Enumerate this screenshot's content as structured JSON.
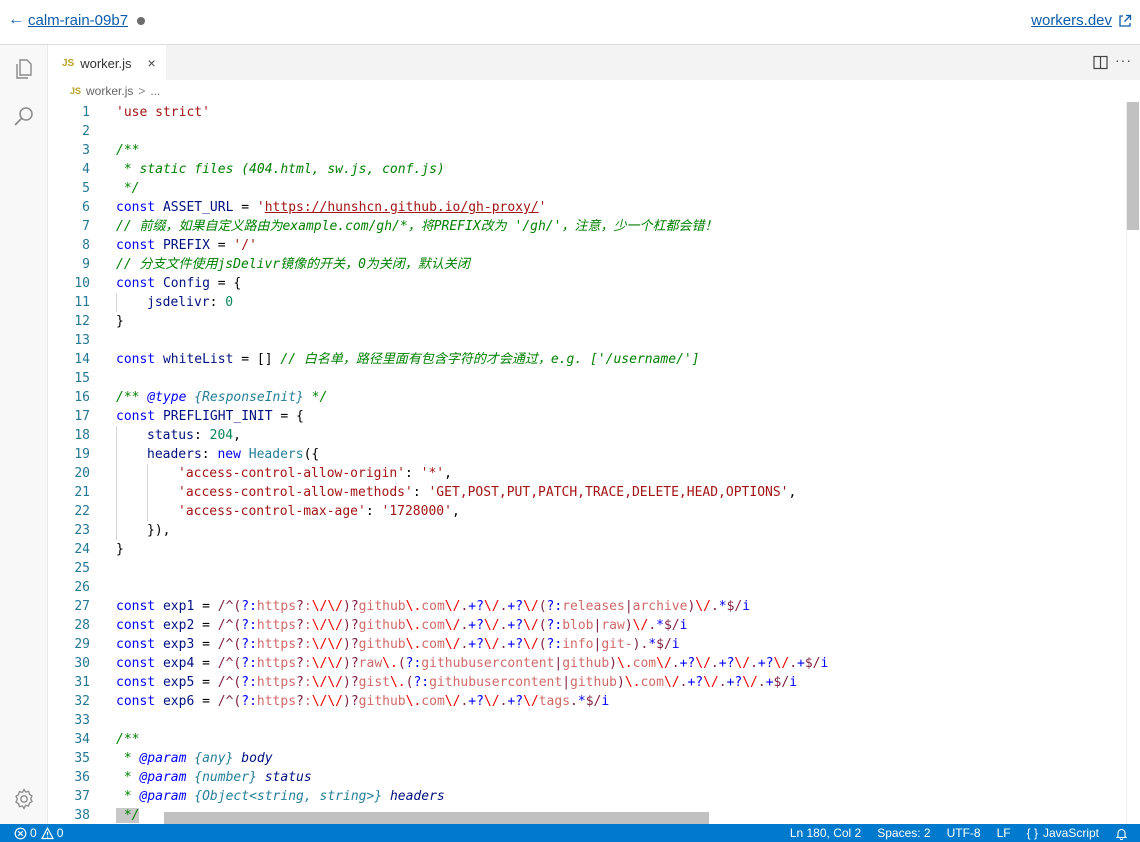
{
  "header": {
    "back_label": "calm-rain-09b7",
    "site_link": "workers.dev"
  },
  "tabs": [
    {
      "icon": "JS",
      "label": "worker.js",
      "close": "×"
    }
  ],
  "breadcrumb": {
    "icon": "JS",
    "file": "worker.js",
    "sep": ">",
    "more": "..."
  },
  "editor": {
    "line_numbers": [
      "1",
      "2",
      "3",
      "4",
      "5",
      "6",
      "7",
      "8",
      "9",
      "10",
      "11",
      "12",
      "13",
      "14",
      "15",
      "16",
      "17",
      "18",
      "19",
      "20",
      "21",
      "22",
      "23",
      "24",
      "25",
      "26",
      "27",
      "28",
      "29",
      "30",
      "31",
      "32",
      "33",
      "34",
      "35",
      "36",
      "37",
      "38"
    ],
    "lines": {
      "l1": "'use strict'",
      "l3": "/**",
      "l4": " * static files (404.html, sw.js, conf.js)",
      "l5": " */",
      "l6_kw": "const",
      "l6_var": " ASSET_URL ",
      "l6_op": "= ",
      "l6_q1": "'",
      "l6_url": "https://hunshcn.github.io/gh-proxy/",
      "l6_q2": "'",
      "l7": "// 前缀，如果自定义路由为example.com/gh/*，将PREFIX改为 '/gh/'，注意，少一个杠都会错！",
      "l8_kw": "const",
      "l8_var": " PREFIX ",
      "l8_op": "= ",
      "l8_str": "'/'",
      "l9": "// 分支文件使用jsDelivr镜像的开关，0为关闭，默认关闭",
      "l10_kw": "const",
      "l10_var": " Config ",
      "l10_rest": "= {",
      "l11_key": "jsdelivr",
      "l11_colon": ": ",
      "l11_num": "0",
      "l12": "}",
      "l14_kw": "const",
      "l14_var": " whiteList ",
      "l14_rest": "= [] ",
      "l14_cmt": "// 白名单，路径里面有包含字符的才会通过，e.g. ['/username/']",
      "l16_a": "/** ",
      "l16_tag": "@type",
      "l16_type": " {ResponseInit}",
      "l16_b": " */",
      "l17_kw": "const",
      "l17_var": " PREFLIGHT_INIT ",
      "l17_rest": "= {",
      "l18_key": "status",
      "l18_colon": ": ",
      "l18_num": "204",
      "l18_end": ",",
      "l19_key": "headers",
      "l19_colon": ": ",
      "l19_new": "new",
      "l19_type": " Headers",
      "l19_end": "({",
      "l20_k": "'access-control-allow-origin'",
      "l20_c": ": ",
      "l20_v": "'*'",
      "l20_e": ",",
      "l21_k": "'access-control-allow-methods'",
      "l21_c": ": ",
      "l21_v": "'GET,POST,PUT,PATCH,TRACE,DELETE,HEAD,OPTIONS'",
      "l21_e": ",",
      "l22_k": "'access-control-max-age'",
      "l22_c": ": ",
      "l22_v": "'1728000'",
      "l22_e": ",",
      "l23": "}),",
      "l24": "}",
      "l38": " */"
    },
    "regex_lines": [
      {
        "name": "exp1",
        "num": "27",
        "parts": [
          [
            "kw",
            "const"
          ],
          [
            "var",
            " exp1 "
          ],
          [
            "pl",
            "= "
          ],
          [
            "re",
            "/^("
          ],
          [
            "rec",
            "?:"
          ],
          [
            "reg",
            "https"
          ],
          [
            "re",
            "?"
          ],
          [
            "reg",
            ":"
          ],
          [
            "reesc",
            "\\/\\/"
          ],
          [
            "re",
            ")?"
          ],
          [
            "reg",
            "github"
          ],
          [
            "reesc",
            "\\."
          ],
          [
            "reg",
            "com"
          ],
          [
            "reesc",
            "\\/"
          ],
          [
            "re",
            "."
          ],
          [
            "rec",
            "+?"
          ],
          [
            "reesc",
            "\\/"
          ],
          [
            "re",
            "."
          ],
          [
            "rec",
            "+?"
          ],
          [
            "reesc",
            "\\/"
          ],
          [
            "re",
            "("
          ],
          [
            "rec",
            "?:"
          ],
          [
            "reg",
            "releases"
          ],
          [
            "re",
            "|"
          ],
          [
            "reg",
            "archive"
          ],
          [
            "re",
            ")"
          ],
          [
            "reesc",
            "\\/"
          ],
          [
            "re",
            "."
          ],
          [
            "rec",
            "*"
          ],
          [
            "re",
            "$/"
          ],
          [
            "kw",
            "i"
          ]
        ]
      },
      {
        "name": "exp2",
        "num": "28",
        "parts": [
          [
            "kw",
            "const"
          ],
          [
            "var",
            " exp2 "
          ],
          [
            "pl",
            "= "
          ],
          [
            "re",
            "/^("
          ],
          [
            "rec",
            "?:"
          ],
          [
            "reg",
            "https"
          ],
          [
            "re",
            "?"
          ],
          [
            "reg",
            ":"
          ],
          [
            "reesc",
            "\\/\\/"
          ],
          [
            "re",
            ")?"
          ],
          [
            "reg",
            "github"
          ],
          [
            "reesc",
            "\\."
          ],
          [
            "reg",
            "com"
          ],
          [
            "reesc",
            "\\/"
          ],
          [
            "re",
            "."
          ],
          [
            "rec",
            "+?"
          ],
          [
            "reesc",
            "\\/"
          ],
          [
            "re",
            "."
          ],
          [
            "rec",
            "+?"
          ],
          [
            "reesc",
            "\\/"
          ],
          [
            "re",
            "("
          ],
          [
            "rec",
            "?:"
          ],
          [
            "reg",
            "blob"
          ],
          [
            "re",
            "|"
          ],
          [
            "reg",
            "raw"
          ],
          [
            "re",
            ")"
          ],
          [
            "reesc",
            "\\/"
          ],
          [
            "re",
            "."
          ],
          [
            "rec",
            "*"
          ],
          [
            "re",
            "$/"
          ],
          [
            "kw",
            "i"
          ]
        ]
      },
      {
        "name": "exp3",
        "num": "29",
        "parts": [
          [
            "kw",
            "const"
          ],
          [
            "var",
            " exp3 "
          ],
          [
            "pl",
            "= "
          ],
          [
            "re",
            "/^("
          ],
          [
            "rec",
            "?:"
          ],
          [
            "reg",
            "https"
          ],
          [
            "re",
            "?"
          ],
          [
            "reg",
            ":"
          ],
          [
            "reesc",
            "\\/\\/"
          ],
          [
            "re",
            ")?"
          ],
          [
            "reg",
            "github"
          ],
          [
            "reesc",
            "\\."
          ],
          [
            "reg",
            "com"
          ],
          [
            "reesc",
            "\\/"
          ],
          [
            "re",
            "."
          ],
          [
            "rec",
            "+?"
          ],
          [
            "reesc",
            "\\/"
          ],
          [
            "re",
            "."
          ],
          [
            "rec",
            "+?"
          ],
          [
            "reesc",
            "\\/"
          ],
          [
            "re",
            "("
          ],
          [
            "rec",
            "?:"
          ],
          [
            "reg",
            "info"
          ],
          [
            "re",
            "|"
          ],
          [
            "reg",
            "git-"
          ],
          [
            "re",
            ")."
          ],
          [
            "rec",
            "*"
          ],
          [
            "re",
            "$/"
          ],
          [
            "kw",
            "i"
          ]
        ]
      },
      {
        "name": "exp4",
        "num": "30",
        "parts": [
          [
            "kw",
            "const"
          ],
          [
            "var",
            " exp4 "
          ],
          [
            "pl",
            "= "
          ],
          [
            "re",
            "/^("
          ],
          [
            "rec",
            "?:"
          ],
          [
            "reg",
            "https"
          ],
          [
            "re",
            "?"
          ],
          [
            "reg",
            ":"
          ],
          [
            "reesc",
            "\\/\\/"
          ],
          [
            "re",
            ")?"
          ],
          [
            "reg",
            "raw"
          ],
          [
            "reesc",
            "\\."
          ],
          [
            "re",
            "("
          ],
          [
            "rec",
            "?:"
          ],
          [
            "reg",
            "githubusercontent"
          ],
          [
            "re",
            "|"
          ],
          [
            "reg",
            "github"
          ],
          [
            "re",
            ")"
          ],
          [
            "reesc",
            "\\."
          ],
          [
            "reg",
            "com"
          ],
          [
            "reesc",
            "\\/"
          ],
          [
            "re",
            "."
          ],
          [
            "rec",
            "+?"
          ],
          [
            "reesc",
            "\\/"
          ],
          [
            "re",
            "."
          ],
          [
            "rec",
            "+?"
          ],
          [
            "reesc",
            "\\/"
          ],
          [
            "re",
            "."
          ],
          [
            "rec",
            "+?"
          ],
          [
            "reesc",
            "\\/"
          ],
          [
            "re",
            "."
          ],
          [
            "rec",
            "+"
          ],
          [
            "re",
            "$/"
          ],
          [
            "kw",
            "i"
          ]
        ]
      },
      {
        "name": "exp5",
        "num": "31",
        "parts": [
          [
            "kw",
            "const"
          ],
          [
            "var",
            " exp5 "
          ],
          [
            "pl",
            "= "
          ],
          [
            "re",
            "/^("
          ],
          [
            "rec",
            "?:"
          ],
          [
            "reg",
            "https"
          ],
          [
            "re",
            "?"
          ],
          [
            "reg",
            ":"
          ],
          [
            "reesc",
            "\\/\\/"
          ],
          [
            "re",
            ")?"
          ],
          [
            "reg",
            "gist"
          ],
          [
            "reesc",
            "\\."
          ],
          [
            "re",
            "("
          ],
          [
            "rec",
            "?:"
          ],
          [
            "reg",
            "githubusercontent"
          ],
          [
            "re",
            "|"
          ],
          [
            "reg",
            "github"
          ],
          [
            "re",
            ")"
          ],
          [
            "reesc",
            "\\."
          ],
          [
            "reg",
            "com"
          ],
          [
            "reesc",
            "\\/"
          ],
          [
            "re",
            "."
          ],
          [
            "rec",
            "+?"
          ],
          [
            "reesc",
            "\\/"
          ],
          [
            "re",
            "."
          ],
          [
            "rec",
            "+?"
          ],
          [
            "reesc",
            "\\/"
          ],
          [
            "re",
            "."
          ],
          [
            "rec",
            "+"
          ],
          [
            "re",
            "$/"
          ],
          [
            "kw",
            "i"
          ]
        ]
      },
      {
        "name": "exp6",
        "num": "32",
        "parts": [
          [
            "kw",
            "const"
          ],
          [
            "var",
            " exp6 "
          ],
          [
            "pl",
            "= "
          ],
          [
            "re",
            "/^("
          ],
          [
            "rec",
            "?:"
          ],
          [
            "reg",
            "https"
          ],
          [
            "re",
            "?"
          ],
          [
            "reg",
            ":"
          ],
          [
            "reesc",
            "\\/\\/"
          ],
          [
            "re",
            ")?"
          ],
          [
            "reg",
            "github"
          ],
          [
            "reesc",
            "\\."
          ],
          [
            "reg",
            "com"
          ],
          [
            "reesc",
            "\\/"
          ],
          [
            "re",
            "."
          ],
          [
            "rec",
            "+?"
          ],
          [
            "reesc",
            "\\/"
          ],
          [
            "re",
            "."
          ],
          [
            "rec",
            "+?"
          ],
          [
            "reesc",
            "\\/"
          ],
          [
            "reg",
            "tags"
          ],
          [
            "re",
            "."
          ],
          [
            "rec",
            "*"
          ],
          [
            "re",
            "$/"
          ],
          [
            "kw",
            "i"
          ]
        ]
      }
    ],
    "doc_lines": {
      "l34": "/**",
      "l35": [
        [
          "cmt",
          " * "
        ],
        [
          "cmtag",
          "@param"
        ],
        [
          "cmtype",
          " {any}"
        ],
        [
          "cmvar",
          " body"
        ]
      ],
      "l36": [
        [
          "cmt",
          " * "
        ],
        [
          "cmtag",
          "@param"
        ],
        [
          "cmtype",
          " {number}"
        ],
        [
          "cmvar",
          " status"
        ]
      ],
      "l37": [
        [
          "cmt",
          " * "
        ],
        [
          "cmtag",
          "@param"
        ],
        [
          "cmtype",
          " {Object<string, string>}"
        ],
        [
          "cmvar",
          " headers"
        ]
      ]
    }
  },
  "statusbar": {
    "errors": "0",
    "warnings": "0",
    "position": "Ln 180, Col 2",
    "spaces": "Spaces: 2",
    "encoding": "UTF-8",
    "eol": "LF",
    "lang_icon": "{ }",
    "language": "JavaScript"
  },
  "colors": {
    "accent": "#007acc",
    "link": "#0b5cad",
    "keyword": "#0000ff",
    "string": "#a31515",
    "comment": "#008000",
    "number": "#098658"
  },
  "icons": [
    "back-arrow-icon",
    "external-link-icon",
    "files-icon",
    "search-icon",
    "settings-gear-icon",
    "split-editor-icon",
    "more-actions-icon",
    "error-icon",
    "warning-icon",
    "bell-icon"
  ]
}
